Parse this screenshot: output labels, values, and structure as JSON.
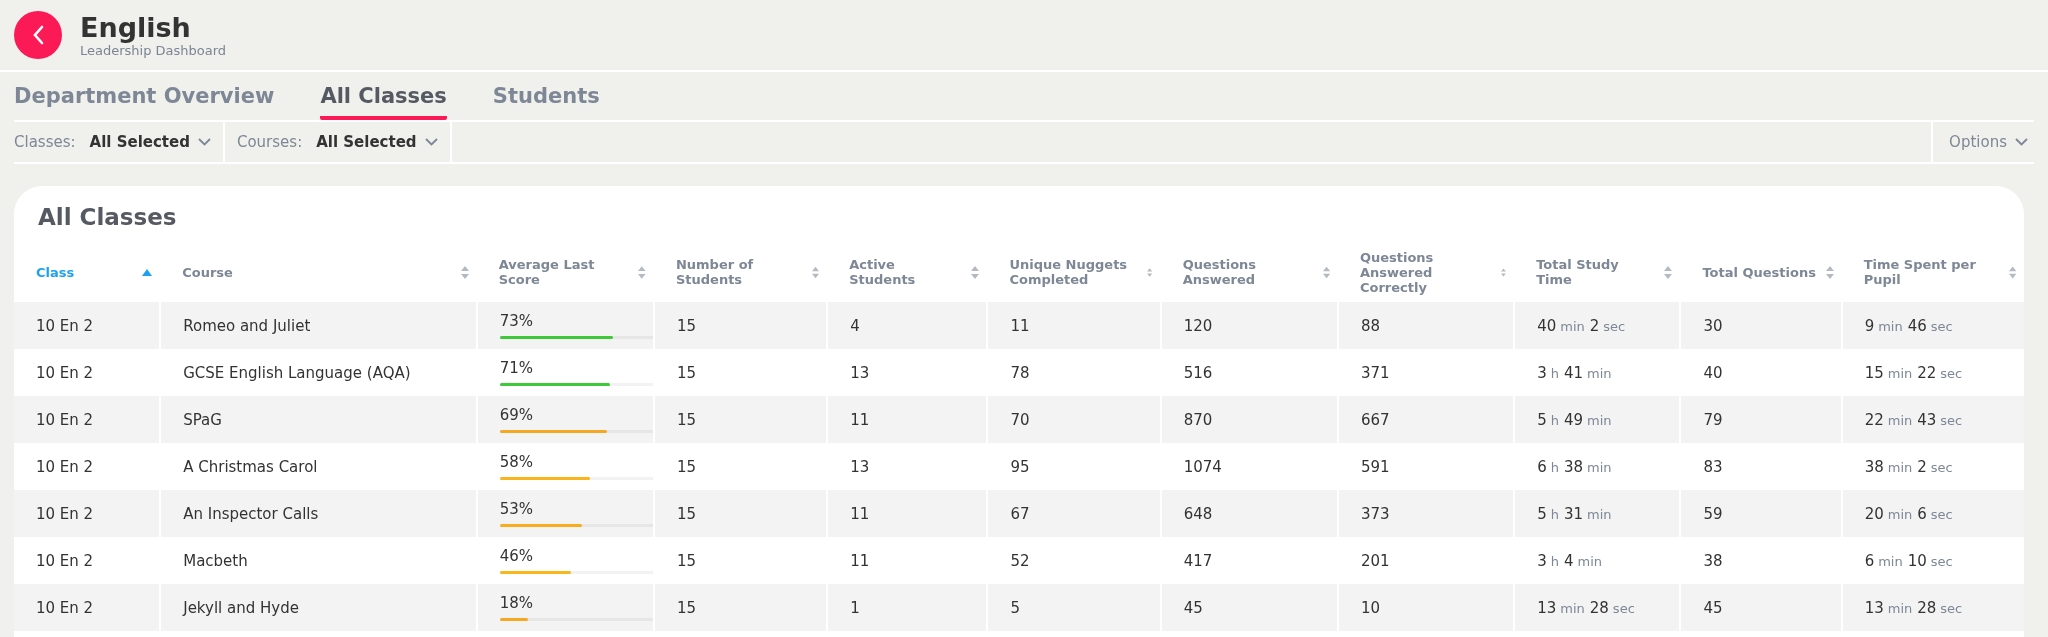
{
  "header": {
    "title": "English",
    "subtitle": "Leadership Dashboard"
  },
  "tabs": [
    {
      "label": "Department Overview",
      "selected": false
    },
    {
      "label": "All Classes",
      "selected": true
    },
    {
      "label": "Students",
      "selected": false
    }
  ],
  "filters": [
    {
      "label": "Classes:",
      "value": "All Selected"
    },
    {
      "label": "Courses:",
      "value": "All Selected"
    }
  ],
  "options": {
    "label": "Options"
  },
  "table": {
    "title": "All Classes",
    "columns": [
      {
        "label": "Class",
        "sorted": true
      },
      {
        "label": "Course",
        "sorted": false
      },
      {
        "label": "Average Last Score",
        "sorted": false
      },
      {
        "label": "Number of Students",
        "sorted": false
      },
      {
        "label": "Active Students",
        "sorted": false
      },
      {
        "label": "Unique Nuggets Completed",
        "sorted": false
      },
      {
        "label": "Questions Answered",
        "sorted": false
      },
      {
        "label": "Questions Answered Correctly",
        "sorted": false
      },
      {
        "label": "Total Study Time",
        "sorted": false
      },
      {
        "label": "Total Questions",
        "sorted": false
      },
      {
        "label": "Time Spent per Pupil",
        "sorted": false
      }
    ],
    "rows": [
      {
        "class": "10 En 2",
        "course": "Romeo and Juliet",
        "score": {
          "text": "73%",
          "level": 0.73,
          "color": "#3ec93a"
        },
        "students": "15",
        "active": "4",
        "nuggets": "11",
        "answered": "120",
        "correct": "88",
        "study_time": [
          {
            "value": "40",
            "unit": "min"
          },
          {
            "value": "2",
            "unit": "sec"
          }
        ],
        "total_questions": "30",
        "per_pupil": [
          {
            "value": "9",
            "unit": "min"
          },
          {
            "value": "46",
            "unit": "sec"
          }
        ]
      },
      {
        "class": "10 En 2",
        "course": "GCSE English Language (AQA)",
        "score": {
          "text": "71%",
          "level": 0.71,
          "color": "#3ec93a"
        },
        "students": "15",
        "active": "13",
        "nuggets": "78",
        "answered": "516",
        "correct": "371",
        "study_time": [
          {
            "value": "3",
            "unit": "h"
          },
          {
            "value": "41",
            "unit": "min"
          }
        ],
        "total_questions": "40",
        "per_pupil": [
          {
            "value": "15",
            "unit": "min"
          },
          {
            "value": "22",
            "unit": "sec"
          }
        ]
      },
      {
        "class": "10 En 2",
        "course": "SPaG",
        "score": {
          "text": "69%",
          "level": 0.69,
          "color": "#f7a823"
        },
        "students": "15",
        "active": "11",
        "nuggets": "70",
        "answered": "870",
        "correct": "667",
        "study_time": [
          {
            "value": "5",
            "unit": "h"
          },
          {
            "value": "49",
            "unit": "min"
          }
        ],
        "total_questions": "79",
        "per_pupil": [
          {
            "value": "22",
            "unit": "min"
          },
          {
            "value": "43",
            "unit": "sec"
          }
        ]
      },
      {
        "class": "10 En 2",
        "course": "A Christmas Carol",
        "score": {
          "text": "58%",
          "level": 0.58,
          "color": "#f9b51b"
        },
        "students": "15",
        "active": "13",
        "nuggets": "95",
        "answered": "1074",
        "correct": "591",
        "study_time": [
          {
            "value": "6",
            "unit": "h"
          },
          {
            "value": "38",
            "unit": "min"
          }
        ],
        "total_questions": "83",
        "per_pupil": [
          {
            "value": "38",
            "unit": "min"
          },
          {
            "value": "2",
            "unit": "sec"
          }
        ]
      },
      {
        "class": "10 En 2",
        "course": "An Inspector Calls",
        "score": {
          "text": "53%",
          "level": 0.53,
          "color": "#f9ad1e"
        },
        "students": "15",
        "active": "11",
        "nuggets": "67",
        "answered": "648",
        "correct": "373",
        "study_time": [
          {
            "value": "5",
            "unit": "h"
          },
          {
            "value": "31",
            "unit": "min"
          }
        ],
        "total_questions": "59",
        "per_pupil": [
          {
            "value": "20",
            "unit": "min"
          },
          {
            "value": "6",
            "unit": "sec"
          }
        ]
      },
      {
        "class": "10 En 2",
        "course": "Macbeth",
        "score": {
          "text": "46%",
          "level": 0.46,
          "color": "#f9b81a"
        },
        "students": "15",
        "active": "11",
        "nuggets": "52",
        "answered": "417",
        "correct": "201",
        "study_time": [
          {
            "value": "3",
            "unit": "h"
          },
          {
            "value": "4",
            "unit": "min"
          }
        ],
        "total_questions": "38",
        "per_pupil": [
          {
            "value": "6",
            "unit": "min"
          },
          {
            "value": "10",
            "unit": "sec"
          }
        ]
      },
      {
        "class": "10 En 2",
        "course": "Jekyll and Hyde",
        "score": {
          "text": "18%",
          "level": 0.18,
          "color": "#f7a823"
        },
        "students": "15",
        "active": "1",
        "nuggets": "5",
        "answered": "45",
        "correct": "10",
        "study_time": [
          {
            "value": "13",
            "unit": "min"
          },
          {
            "value": "28",
            "unit": "sec"
          }
        ],
        "total_questions": "45",
        "per_pupil": [
          {
            "value": "13",
            "unit": "min"
          },
          {
            "value": "28",
            "unit": "sec"
          }
        ]
      }
    ]
  }
}
